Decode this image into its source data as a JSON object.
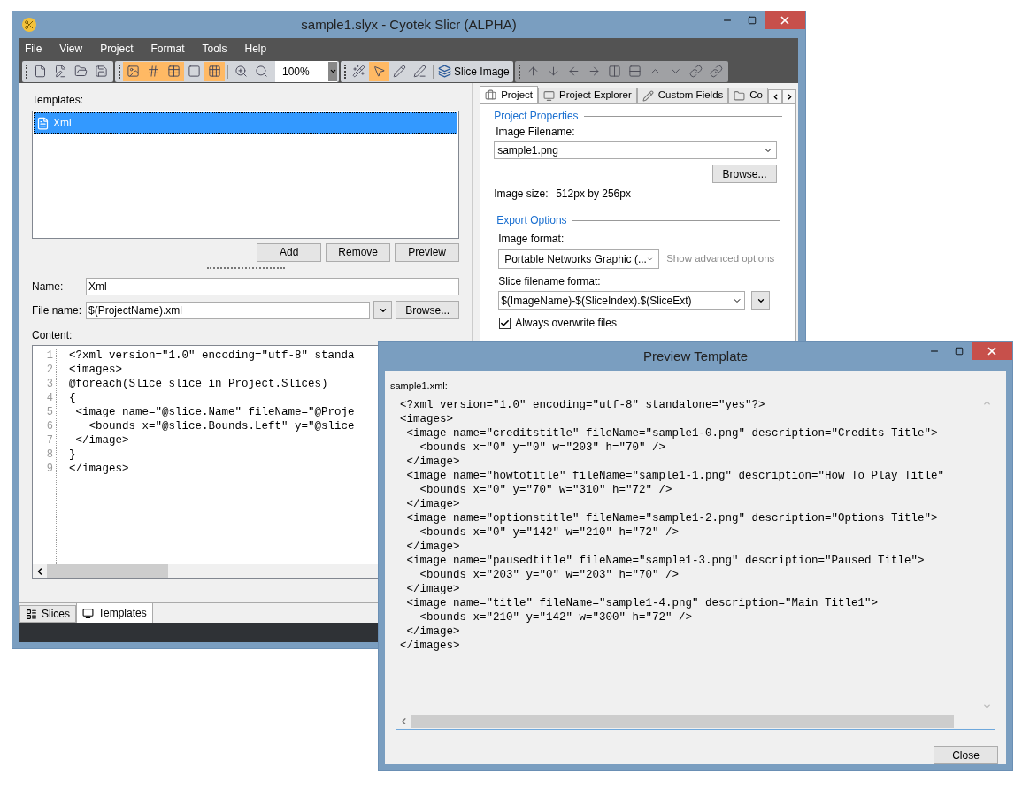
{
  "main_window": {
    "title": "sample1.slyx - Cyotek Slicr  (ALPHA)",
    "menu": [
      "File",
      "View",
      "Project",
      "Format",
      "Tools",
      "Help"
    ],
    "toolbar": {
      "file_buttons": [
        {
          "selected": false
        },
        {
          "selected": false
        },
        {
          "selected": false
        },
        {
          "selected": false
        }
      ],
      "view_toggles": [
        {
          "selected": true
        },
        {
          "selected": true
        },
        {
          "selected": true
        },
        {
          "selected": false
        },
        {
          "selected": true
        }
      ],
      "zoom": "100%",
      "tool_buttons": [
        {
          "selected": false
        },
        {
          "selected": true
        },
        {
          "selected": false
        },
        {
          "selected": false
        }
      ],
      "slice_button": "Slice Image"
    },
    "templates": {
      "label": "Templates:",
      "items": [
        {
          "label": "Xml",
          "selected": true
        }
      ],
      "buttons": [
        "Add",
        "Remove",
        "Preview"
      ],
      "name_label": "Name:",
      "name_value": "Xml",
      "file_label": "File name:",
      "file_value": "$(ProjectName).xml",
      "browse": "Browse...",
      "content_label": "Content:",
      "code_lines": [
        {
          "number": "1",
          "text": "<?xml version=\"1.0\" encoding=\"utf-8\" standa"
        },
        {
          "number": "2",
          "text": "<images>"
        },
        {
          "number": "3",
          "text": "@foreach(Slice slice in Project.Slices)"
        },
        {
          "number": "4",
          "text": "{"
        },
        {
          "number": "5",
          "text": " <image name=\"@slice.Name\" fileName=\"@Proje"
        },
        {
          "number": "6",
          "text": "   <bounds x=\"@slice.Bounds.Left\" y=\"@slice"
        },
        {
          "number": "7",
          "text": " </image>"
        },
        {
          "number": "8",
          "text": "}"
        },
        {
          "number": "9",
          "text": "</images>"
        }
      ]
    },
    "bottom_tabs": [
      {
        "label": "Slices",
        "selected": false
      },
      {
        "label": "Templates",
        "selected": true
      }
    ],
    "right_tabs": [
      {
        "label": "Project",
        "selected": true
      },
      {
        "label": "Project Explorer",
        "selected": false
      },
      {
        "label": "Custom Fields",
        "selected": false
      },
      {
        "label": "Co",
        "selected": false
      }
    ],
    "project": {
      "properties_heading": "Project Properties",
      "image_filename_label": "Image Filename:",
      "image_filename": "sample1.png",
      "browse": "Browse...",
      "image_size_label": "Image size:",
      "image_size": "512px by 256px",
      "export_heading": "Export Options",
      "image_format_label": "Image format:",
      "image_format": "Portable Networks Graphic (...",
      "advanced_link": "Show advanced options",
      "slice_format_label": "Slice filename format:",
      "slice_format": "$(ImageName)-$(SliceIndex).$(SliceExt)",
      "overwrite": {
        "label": "Always overwrite files",
        "checked": true
      }
    }
  },
  "preview_dialog": {
    "title": "Preview Template",
    "file_label": "sample1.xml:",
    "lines": [
      "<?xml version=\"1.0\" encoding=\"utf-8\" standalone=\"yes\"?>",
      "<images>",
      " <image name=\"creditstitle\" fileName=\"sample1-0.png\" description=\"Credits Title\">",
      "   <bounds x=\"0\" y=\"0\" w=\"203\" h=\"70\" />",
      " </image>",
      " <image name=\"howtotitle\" fileName=\"sample1-1.png\" description=\"How To Play Title\"",
      "   <bounds x=\"0\" y=\"70\" w=\"310\" h=\"72\" />",
      " </image>",
      " <image name=\"optionstitle\" fileName=\"sample1-2.png\" description=\"Options Title\">",
      "   <bounds x=\"0\" y=\"142\" w=\"210\" h=\"72\" />",
      " </image>",
      " <image name=\"pausedtitle\" fileName=\"sample1-3.png\" description=\"Paused Title\">",
      "   <bounds x=\"203\" y=\"0\" w=\"203\" h=\"70\" />",
      " </image>",
      " <image name=\"title\" fileName=\"sample1-4.png\" description=\"Main Title1\">",
      "   <bounds x=\"210\" y=\"142\" w=\"300\" h=\"72\" />",
      " </image>",
      "</images>"
    ],
    "close_button": "Close"
  }
}
